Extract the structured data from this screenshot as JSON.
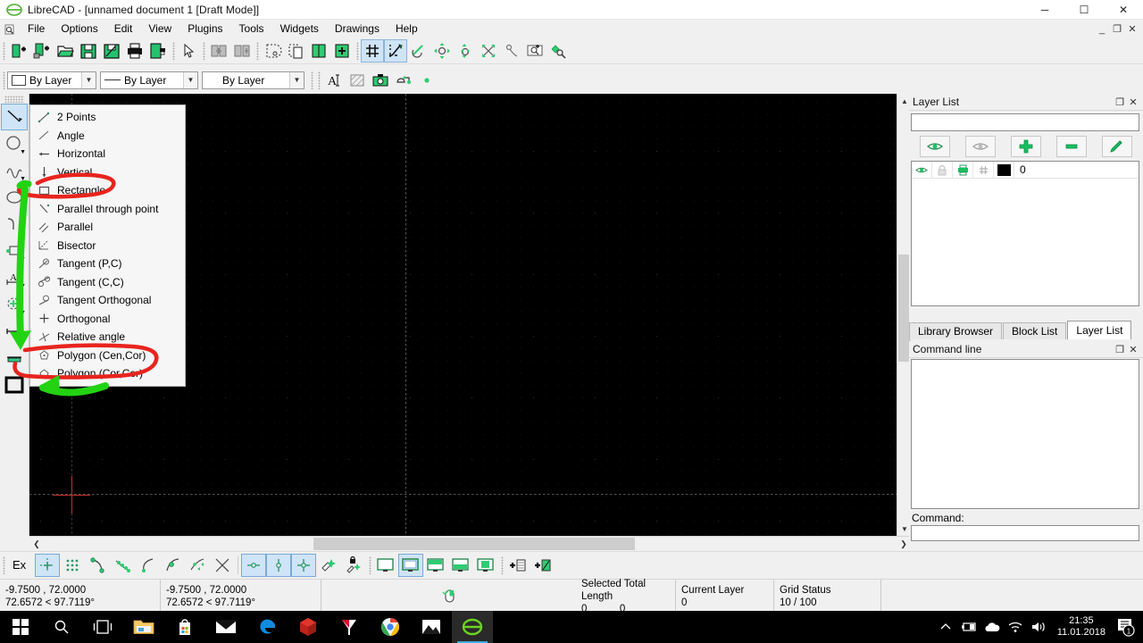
{
  "window": {
    "title": "LibreCAD - [unnamed document 1 [Draft Mode]]",
    "minimize": "─",
    "maximize": "☐",
    "close": "✕",
    "mdi_minimize": "_",
    "mdi_restore": "❐",
    "mdi_close": "✕"
  },
  "menubar": {
    "items": [
      {
        "label": "File"
      },
      {
        "label": "Options"
      },
      {
        "label": "Edit"
      },
      {
        "label": "View"
      },
      {
        "label": "Plugins"
      },
      {
        "label": "Tools"
      },
      {
        "label": "Widgets"
      },
      {
        "label": "Drawings"
      },
      {
        "label": "Help"
      }
    ]
  },
  "toolbar_file": [
    {
      "name": "new-file-icon",
      "tip": "New"
    },
    {
      "name": "new-from-template-icon",
      "tip": "New from template"
    },
    {
      "name": "open-file-icon",
      "tip": "Open"
    },
    {
      "name": "save-icon",
      "tip": "Save"
    },
    {
      "name": "save-as-icon",
      "tip": "Save as"
    },
    {
      "name": "print-icon",
      "tip": "Print"
    },
    {
      "name": "print-preview-icon",
      "tip": "Print preview"
    }
  ],
  "toolbar_edit": [
    {
      "name": "select-pointer-icon",
      "tip": "Select"
    },
    {
      "name": "undo-icon",
      "tip": "Undo"
    },
    {
      "name": "redo-icon",
      "tip": "Redo"
    },
    {
      "name": "cut-icon",
      "tip": "Cut"
    },
    {
      "name": "copy-icon",
      "tip": "Copy"
    },
    {
      "name": "paste-icon",
      "tip": "Paste"
    }
  ],
  "toolbar_view": [
    {
      "name": "grid-toggle-icon",
      "tip": "Grid",
      "active": true
    },
    {
      "name": "draft-mode-icon",
      "tip": "Draft mode",
      "active": true
    },
    {
      "name": "zoom-redraw-icon",
      "tip": "Redraw"
    },
    {
      "name": "zoom-in-icon",
      "tip": "Zoom in"
    },
    {
      "name": "zoom-out-icon",
      "tip": "Zoom out"
    },
    {
      "name": "zoom-auto-icon",
      "tip": "Auto zoom"
    },
    {
      "name": "zoom-pan-icon",
      "tip": "Pan zoom"
    },
    {
      "name": "zoom-window-icon",
      "tip": "Zoom window"
    },
    {
      "name": "zoom-previous-icon",
      "tip": "Previous view"
    }
  ],
  "attributes_bar": {
    "layer_combo": {
      "value": "By Layer",
      "name": "pen-color-combo"
    },
    "linetype_combo": {
      "value": "By Layer",
      "name": "pen-linetype-combo"
    },
    "width_combo": {
      "value": "By Layer",
      "name": "pen-width-combo"
    },
    "extra": [
      {
        "name": "text-tool-icon",
        "tip": "Text"
      },
      {
        "name": "hatch-tool-icon",
        "tip": "Hatch"
      },
      {
        "name": "image-tool-icon",
        "tip": "Insert image"
      },
      {
        "name": "block-tool-icon",
        "tip": "Block"
      },
      {
        "name": "point-tool-icon",
        "tip": "Point"
      }
    ]
  },
  "left_tools": [
    {
      "name": "line-tool",
      "tip": "Line",
      "selected": true,
      "caret": false
    },
    {
      "name": "circle-tool",
      "tip": "Circle",
      "selected": false,
      "caret": true
    },
    {
      "name": "spline-tool",
      "tip": "Curve / Spline",
      "selected": false,
      "caret": true
    },
    {
      "name": "ellipse-tool",
      "tip": "Ellipse",
      "selected": false,
      "caret": true
    },
    {
      "name": "polyline-tool",
      "tip": "Polyline",
      "selected": false,
      "caret": true
    },
    {
      "name": "select-tool",
      "tip": "Select",
      "selected": false,
      "caret": true
    },
    {
      "name": "dimension-tool",
      "tip": "Dimension",
      "selected": false,
      "caret": true
    },
    {
      "name": "modify-tool",
      "tip": "Modify",
      "selected": false,
      "caret": true
    },
    {
      "name": "info-tool",
      "tip": "Info",
      "selected": false,
      "caret": true
    },
    {
      "name": "layer-tool",
      "tip": "Layer",
      "selected": false,
      "caret": false
    },
    {
      "name": "block-tool",
      "tip": "Block",
      "selected": false,
      "caret": false
    }
  ],
  "context_menu": {
    "name": "line-tools-menu",
    "items": [
      {
        "label": "2 Points",
        "icon": "line-2points-icon"
      },
      {
        "label": "Angle",
        "icon": "line-angle-icon"
      },
      {
        "label": "Horizontal",
        "icon": "line-horizontal-icon"
      },
      {
        "label": "Vertical",
        "icon": "line-vertical-icon"
      },
      {
        "label": "Rectangle",
        "icon": "line-rectangle-icon"
      },
      {
        "label": "Parallel through point",
        "icon": "line-parallel-through-point-icon"
      },
      {
        "label": "Parallel",
        "icon": "line-parallel-icon"
      },
      {
        "label": "Bisector",
        "icon": "line-bisector-icon"
      },
      {
        "label": "Tangent (P,C)",
        "icon": "line-tangent-pc-icon"
      },
      {
        "label": "Tangent (C,C)",
        "icon": "line-tangent-cc-icon"
      },
      {
        "label": "Tangent Orthogonal",
        "icon": "line-tangent-orthogonal-icon"
      },
      {
        "label": "Orthogonal",
        "icon": "line-orthogonal-icon"
      },
      {
        "label": "Relative angle",
        "icon": "line-relative-angle-icon"
      },
      {
        "label": "Polygon (Cen,Cor)",
        "icon": "polygon-center-corner-icon"
      },
      {
        "label": "Polygon (Cor,Cor)",
        "icon": "polygon-corner-corner-icon"
      }
    ]
  },
  "layer_dock": {
    "title": "Layer List",
    "float_btn": "❐",
    "close_btn": "✕",
    "filter_value": "",
    "actions": [
      {
        "name": "show-all-layers-button",
        "icon": "eye-open-icon"
      },
      {
        "name": "hide-all-layers-button",
        "icon": "eye-closed-icon"
      },
      {
        "name": "add-layer-button",
        "icon": "plus-icon"
      },
      {
        "name": "remove-layer-button",
        "icon": "minus-icon"
      },
      {
        "name": "edit-layer-button",
        "icon": "pencil-icon"
      }
    ],
    "columns": [
      "visible",
      "locked",
      "printable",
      "construction",
      "color",
      "name"
    ],
    "rows": [
      {
        "visible": true,
        "locked": false,
        "printable": true,
        "construction": false,
        "color": "#000000",
        "name": "0"
      }
    ]
  },
  "dock_tabs": [
    {
      "label": "Library Browser",
      "active": false
    },
    {
      "label": "Block List",
      "active": false
    },
    {
      "label": "Layer List",
      "active": true
    }
  ],
  "command_dock": {
    "title": "Command line",
    "float_btn": "❐",
    "close_btn": "✕",
    "output": "",
    "prompt_label": "Command:",
    "input_value": ""
  },
  "snap_bar": {
    "ex_label": "Ex",
    "buttons": [
      {
        "name": "snap-free-button",
        "on": true
      },
      {
        "name": "snap-grid-button",
        "on": false
      },
      {
        "name": "snap-endpoint-button",
        "on": false
      },
      {
        "name": "snap-entity-button",
        "on": false
      },
      {
        "name": "snap-center-button",
        "on": false
      },
      {
        "name": "snap-middle-button",
        "on": false
      },
      {
        "name": "snap-distance-button",
        "on": false
      },
      {
        "name": "snap-intersection-button",
        "on": false
      },
      {
        "name": "restrict-horizontal-button",
        "on": true
      },
      {
        "name": "restrict-vertical-button",
        "on": true
      },
      {
        "name": "restrict-orthogonal-button",
        "on": true
      },
      {
        "name": "relative-zero-button",
        "on": false
      },
      {
        "name": "lock-relative-zero-button",
        "on": false
      }
    ],
    "view_buttons": [
      {
        "name": "view-mode-1-button",
        "on": false
      },
      {
        "name": "view-mode-2-button",
        "on": true
      },
      {
        "name": "view-mode-3-button",
        "on": false
      },
      {
        "name": "view-mode-4-button",
        "on": false
      },
      {
        "name": "view-mode-5-button",
        "on": false
      }
    ],
    "add_buttons": [
      {
        "name": "add-layer-shortcut-button"
      },
      {
        "name": "add-block-shortcut-button"
      }
    ]
  },
  "status_bar": {
    "abs_coord_line1": "-9.7500 , 72.0000",
    "abs_coord_line2": "72.6572 < 97.7119°",
    "rel_coord_line1": "-9.7500 , 72.0000",
    "rel_coord_line2": "72.6572 < 97.7119°",
    "mouse_widget": "mouse-hint-icon",
    "selected_header": "Selected Total Length",
    "selected_value_a": "0",
    "selected_value_b": "0",
    "current_layer_header": "Current Layer",
    "current_layer_value": "0",
    "grid_status_header": "Grid Status",
    "grid_status_value": "10 / 100"
  },
  "taskbar": {
    "items": [
      {
        "name": "start-button",
        "icon": "windows-logo-icon"
      },
      {
        "name": "search-button",
        "icon": "search-icon"
      },
      {
        "name": "task-view-button",
        "icon": "task-view-icon"
      },
      {
        "name": "file-explorer-button",
        "icon": "folder-icon"
      },
      {
        "name": "microsoft-store-button",
        "icon": "store-bag-icon"
      },
      {
        "name": "mail-button",
        "icon": "envelope-icon"
      },
      {
        "name": "edge-button",
        "icon": "edge-e-icon"
      },
      {
        "name": "red-cube-app-button",
        "icon": "red-cube-icon"
      },
      {
        "name": "yandex-browser-button",
        "icon": "yandex-y-icon"
      },
      {
        "name": "chrome-button",
        "icon": "chrome-icon"
      },
      {
        "name": "photos-button",
        "icon": "photos-mountain-icon"
      },
      {
        "name": "librecad-button",
        "icon": "librecad-logo-icon"
      }
    ],
    "tray": [
      {
        "name": "show-hidden-icons-button",
        "glyph": "⌃"
      },
      {
        "name": "battery-icon",
        "glyph": "ὐB"
      },
      {
        "name": "onedrive-icon",
        "glyph": "☁"
      },
      {
        "name": "wifi-icon",
        "glyph": "◠"
      },
      {
        "name": "volume-icon",
        "glyph": "ὐA"
      }
    ],
    "clock_time": "21:35",
    "clock_date": "11.01.2018",
    "notification_count": "1"
  },
  "annotations": {
    "highlight_color": "#e8241e",
    "arrow_color": "#23d313",
    "targets": [
      "Rectangle",
      "Polygon (Cen,Cor)",
      "Polygon (Cor,Cor)"
    ]
  },
  "canvas": {
    "background": "#000000",
    "grid_color": "#2e2e2e",
    "crosshair_color": "#c23030"
  }
}
